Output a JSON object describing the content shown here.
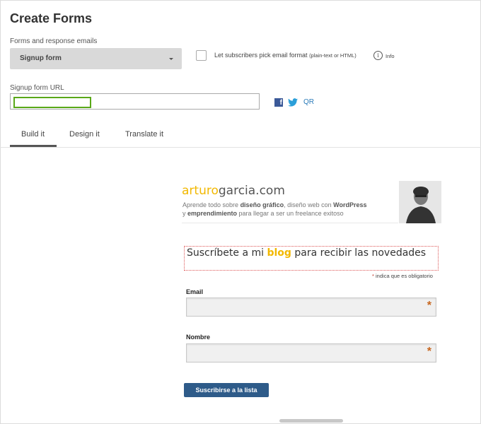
{
  "page": {
    "title": "Create Forms"
  },
  "forms_section": {
    "label": "Forms and response emails",
    "selected_form": "Signup form",
    "checkbox_label": "Let subscribers pick email format",
    "checkbox_hint": "(plain-text or HTML)",
    "info_label": "Info"
  },
  "url_section": {
    "label": "Signup form URL",
    "url_value": "",
    "qr_label": "QR"
  },
  "tabs": [
    {
      "label": "Build it",
      "active": true
    },
    {
      "label": "Design it",
      "active": false
    },
    {
      "label": "Translate it",
      "active": false
    }
  ],
  "preview": {
    "logo_part1": "arturo",
    "logo_part2": "garcia.com",
    "tagline_1a": "Aprende todo sobre ",
    "tagline_1b": "diseño gráfico",
    "tagline_1c": ", diseño web con ",
    "tagline_1d": "WordPress",
    "tagline_2a": "y ",
    "tagline_2b": "emprendimiento",
    "tagline_2c": " para llegar a ser un freelance exitoso",
    "form_title_a": "Suscríbete a mi ",
    "form_title_b": "blog",
    "form_title_c": " para recibir las novedades",
    "required_note": "indica que es obligatorio",
    "fields": [
      {
        "label": "Email",
        "required": true
      },
      {
        "label": "Nombre",
        "required": true
      }
    ],
    "submit_label": "Suscribirse a la lista"
  },
  "colors": {
    "accent": "#f2b800",
    "button": "#2e5b89",
    "facebook": "#3b5998",
    "twitter": "#2b9fd9",
    "focus_outline": "#59a818"
  },
  "icons": [
    "facebook-icon",
    "twitter-icon",
    "info-icon",
    "chevron-down-icon"
  ]
}
